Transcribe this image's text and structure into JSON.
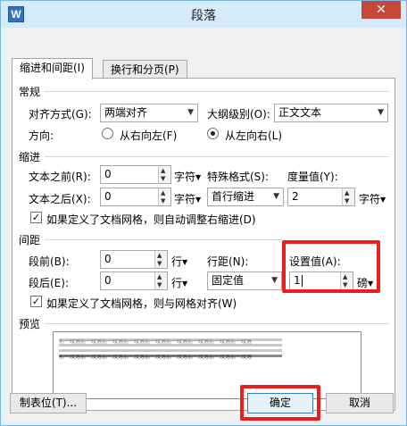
{
  "window": {
    "title": "段落",
    "app_icon": "W",
    "close": "✕"
  },
  "tabs": [
    {
      "label": "缩进和间距(I)",
      "active": true
    },
    {
      "label": "换行和分页(P)",
      "active": false
    }
  ],
  "general": {
    "section": "常规",
    "align_label": "对齐方式(G):",
    "align_value": "两端对齐",
    "outline_label": "大纲级别(O):",
    "outline_value": "正文文本",
    "direction_label": "方向:",
    "rtl_label": "从右向左(F)",
    "ltr_label": "从左向右(L)",
    "direction_selected": "ltr"
  },
  "indent": {
    "section": "缩进",
    "before_label": "文本之前(R):",
    "before_value": "0",
    "before_unit": "字符",
    "after_label": "文本之后(X):",
    "after_value": "0",
    "after_unit": "字符",
    "special_label": "特殊格式(S):",
    "special_value": "首行缩进",
    "measure_label": "度量值(Y):",
    "measure_value": "2",
    "measure_unit": "字符",
    "grid_check_label": "如果定义了文档网格，则自动调整右缩进(D)",
    "grid_checked": true
  },
  "spacing": {
    "section": "间距",
    "before_label": "段前(B):",
    "before_value": "0",
    "before_unit": "行",
    "after_label": "段后(E):",
    "after_value": "0",
    "after_unit": "行",
    "line_label": "行距(N):",
    "line_value": "固定值",
    "set_label": "设置值(A):",
    "set_value": "1",
    "set_unit": "磅",
    "grid_check_label": "如果定义了文档网格，则与网格对齐(W)",
    "grid_checked": true
  },
  "preview": {
    "section": "预览",
    "sample_text": "前一段落前一段落前一段落前一段落前一段落前一段落前一段落前一段落前一段落",
    "current_text": "前一段落前一段落前一段落前一段落前一段落前一段落前一段落前一段落前一段落"
  },
  "buttons": {
    "tabs": "制表位(T)...",
    "ok": "确定",
    "cancel": "取消"
  },
  "colors": {
    "highlight": "#e82020",
    "frame": "#7ab6dd"
  },
  "icons": {
    "dropdown": "triangle-down",
    "spin": "up-down-arrows",
    "check": "checkmark"
  }
}
